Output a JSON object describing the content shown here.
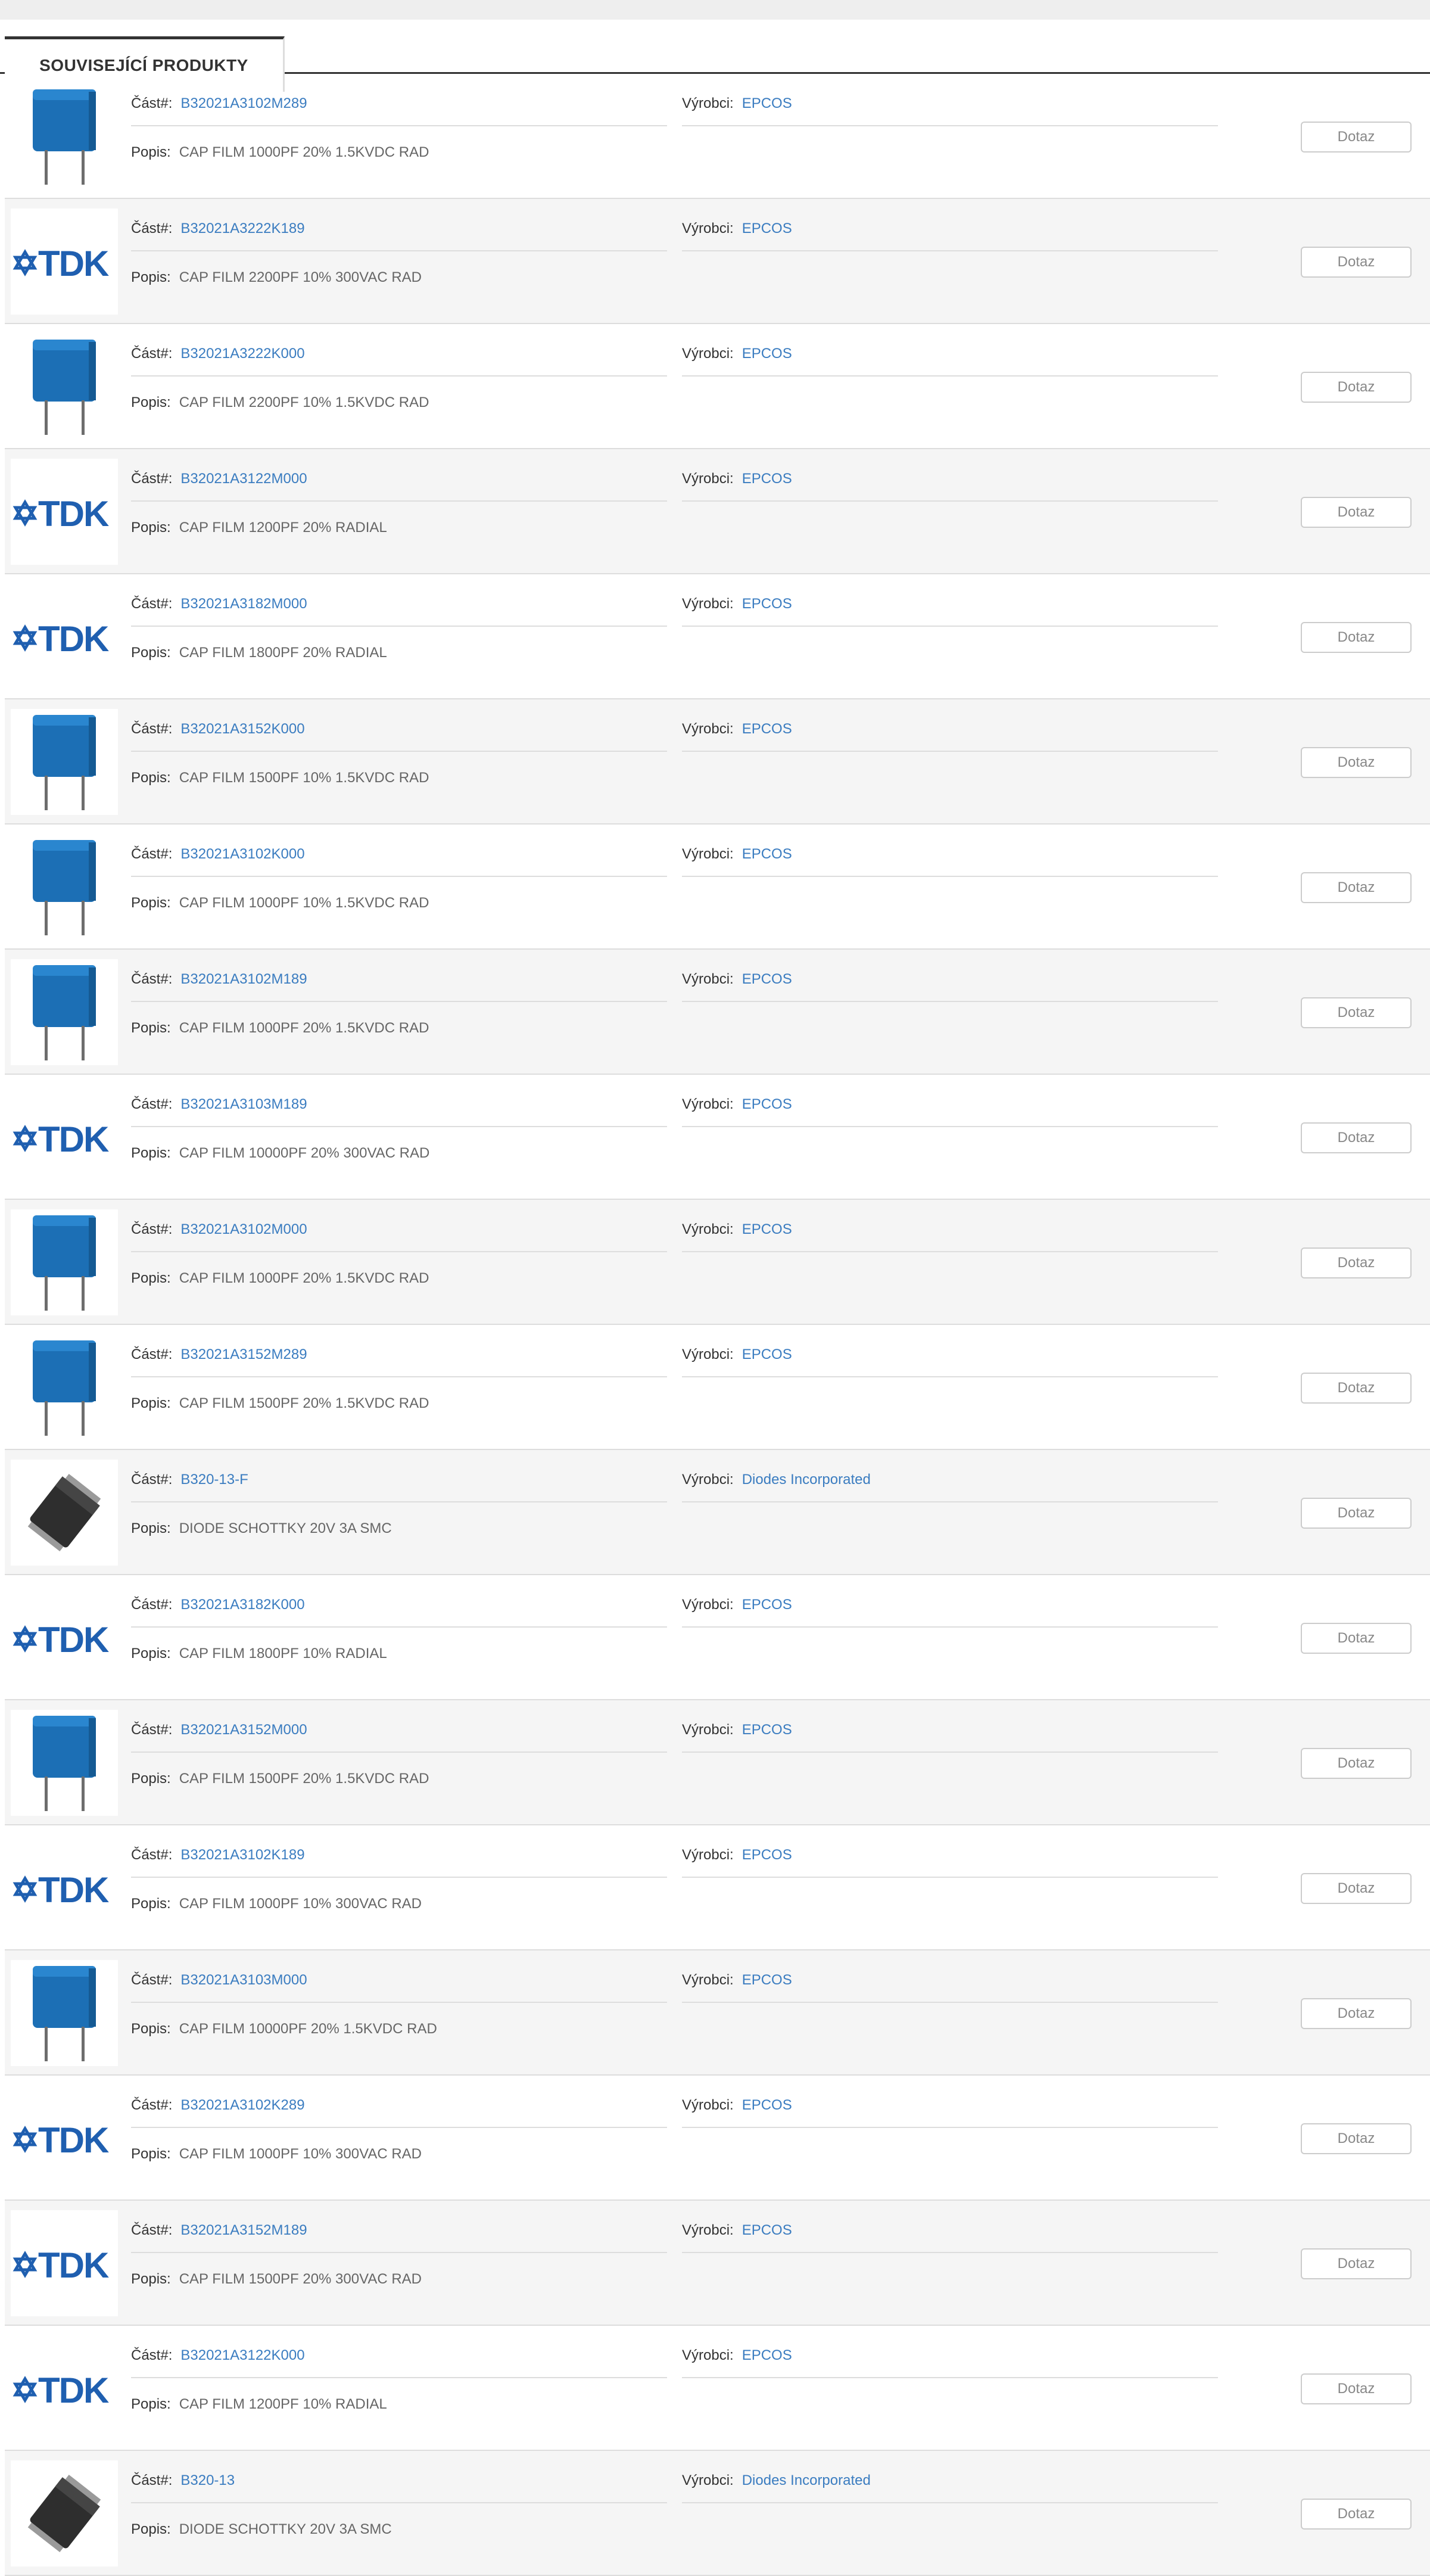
{
  "tab": {
    "label": "SOUVISEJÍCÍ PRODUKTY"
  },
  "labels": {
    "part": "Část#:",
    "manufacturer": "Výrobci:",
    "description": "Popis:",
    "inquiry": "Dotaz"
  },
  "colors": {
    "link": "#3a7cc0",
    "tdk_blue": "#1f5fb0",
    "capacitor_blue": "#1c6fb5",
    "row_alt": "#f5f5f5"
  },
  "products": [
    {
      "image": "capacitor",
      "part": "B32021A3102M289",
      "manufacturer": "EPCOS",
      "description": "CAP FILM 1000PF 20% 1.5KVDC RAD"
    },
    {
      "image": "tdk-logo",
      "part": "B32021A3222K189",
      "manufacturer": "EPCOS",
      "description": "CAP FILM 2200PF 10% 300VAC RAD"
    },
    {
      "image": "capacitor",
      "part": "B32021A3222K000",
      "manufacturer": "EPCOS",
      "description": "CAP FILM 2200PF 10% 1.5KVDC RAD"
    },
    {
      "image": "tdk-logo",
      "part": "B32021A3122M000",
      "manufacturer": "EPCOS",
      "description": "CAP FILM 1200PF 20% RADIAL"
    },
    {
      "image": "tdk-logo",
      "part": "B32021A3182M000",
      "manufacturer": "EPCOS",
      "description": "CAP FILM 1800PF 20% RADIAL"
    },
    {
      "image": "capacitor",
      "part": "B32021A3152K000",
      "manufacturer": "EPCOS",
      "description": "CAP FILM 1500PF 10% 1.5KVDC RAD"
    },
    {
      "image": "capacitor",
      "part": "B32021A3102K000",
      "manufacturer": "EPCOS",
      "description": "CAP FILM 1000PF 10% 1.5KVDC RAD"
    },
    {
      "image": "capacitor",
      "part": "B32021A3102M189",
      "manufacturer": "EPCOS",
      "description": "CAP FILM 1000PF 20% 1.5KVDC RAD"
    },
    {
      "image": "tdk-logo",
      "part": "B32021A3103M189",
      "manufacturer": "EPCOS",
      "description": "CAP FILM 10000PF 20% 300VAC RAD"
    },
    {
      "image": "capacitor",
      "part": "B32021A3102M000",
      "manufacturer": "EPCOS",
      "description": "CAP FILM 1000PF 20% 1.5KVDC RAD"
    },
    {
      "image": "capacitor",
      "part": "B32021A3152M289",
      "manufacturer": "EPCOS",
      "description": "CAP FILM 1500PF 20% 1.5KVDC RAD"
    },
    {
      "image": "diode",
      "part": "B320-13-F",
      "manufacturer": "Diodes Incorporated",
      "description": "DIODE SCHOTTKY 20V 3A SMC"
    },
    {
      "image": "tdk-logo",
      "part": "B32021A3182K000",
      "manufacturer": "EPCOS",
      "description": "CAP FILM 1800PF 10% RADIAL"
    },
    {
      "image": "capacitor",
      "part": "B32021A3152M000",
      "manufacturer": "EPCOS",
      "description": "CAP FILM 1500PF 20% 1.5KVDC RAD"
    },
    {
      "image": "tdk-logo",
      "part": "B32021A3102K189",
      "manufacturer": "EPCOS",
      "description": "CAP FILM 1000PF 10% 300VAC RAD"
    },
    {
      "image": "capacitor",
      "part": "B32021A3103M000",
      "manufacturer": "EPCOS",
      "description": "CAP FILM 10000PF 20% 1.5KVDC RAD"
    },
    {
      "image": "tdk-logo",
      "part": "B32021A3102K289",
      "manufacturer": "EPCOS",
      "description": "CAP FILM 1000PF 10% 300VAC RAD"
    },
    {
      "image": "tdk-logo",
      "part": "B32021A3152M189",
      "manufacturer": "EPCOS",
      "description": "CAP FILM 1500PF 20% 300VAC RAD"
    },
    {
      "image": "tdk-logo",
      "part": "B32021A3122K000",
      "manufacturer": "EPCOS",
      "description": "CAP FILM 1200PF 10% RADIAL"
    },
    {
      "image": "diode",
      "part": "B320-13",
      "manufacturer": "Diodes Incorporated",
      "description": "DIODE SCHOTTKY 20V 3A SMC"
    }
  ]
}
